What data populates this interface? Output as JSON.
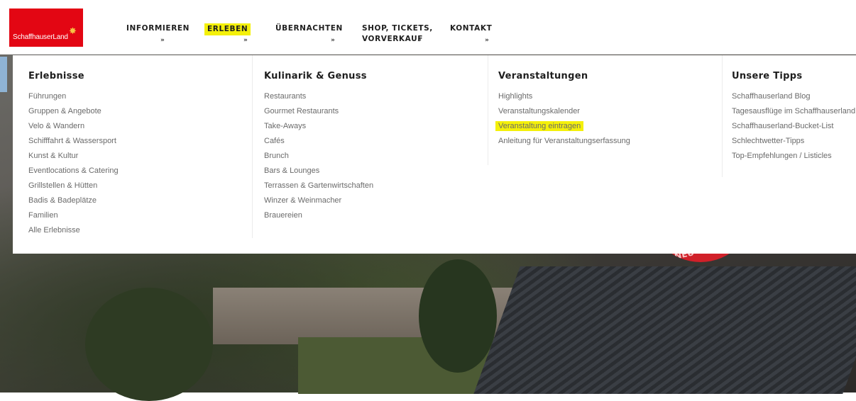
{
  "brand": {
    "logo_text": "SchaffhauserLand"
  },
  "nav": [
    {
      "label": "INFORMIEREN",
      "highlighted": false
    },
    {
      "label": "ERLEBEN",
      "highlighted": true
    },
    {
      "label": "ÜBERNACHTEN",
      "highlighted": false
    },
    {
      "label": "SHOP, TICKETS,",
      "label2": "VORVERKAUF",
      "highlighted": false
    },
    {
      "label": "KONTAKT",
      "highlighted": false
    }
  ],
  "chevron_icon": "double-chevron-down",
  "highlight_color": "#f4f00a",
  "brand_color": "#e30613",
  "menu": {
    "erlebnisse": {
      "title": "Erlebnisse",
      "items": [
        "Führungen",
        "Gruppen & Angebote",
        "Velo & Wandern",
        "Schifffahrt & Wassersport",
        "Kunst & Kultur",
        "Eventlocations & Catering",
        "Grillstellen & Hütten",
        "Badis & Badeplätze",
        "Familien",
        "Alle Erlebnisse"
      ]
    },
    "kulinarik": {
      "title": "Kulinarik & Genuss",
      "items": [
        "Restaurants",
        "Gourmet Restaurants",
        "Take-Aways",
        "Cafés",
        "Brunch",
        "Bars & Lounges",
        "Terrassen & Gartenwirtschaften",
        "Winzer & Weinmacher",
        "Brauereien"
      ]
    },
    "veranstaltungen": {
      "title": "Veranstaltungen",
      "items": [
        "Highlights",
        "Veranstaltungskalender",
        "Veranstaltung eintragen",
        "Anleitung für Veranstaltungserfassung"
      ],
      "highlighted_item": "Veranstaltung eintragen"
    },
    "tipps": {
      "title": "Unsere Tipps",
      "items": [
        "Schaffhauserland Blog",
        "Tagesausflüge im Schaffhauserland",
        "Schaffhauserland-Bucket-List",
        "Schlechtwetter-Tipps",
        "Top-Empfehlungen / Listicles"
      ]
    }
  },
  "hero": {
    "badge_text": "NEU"
  }
}
